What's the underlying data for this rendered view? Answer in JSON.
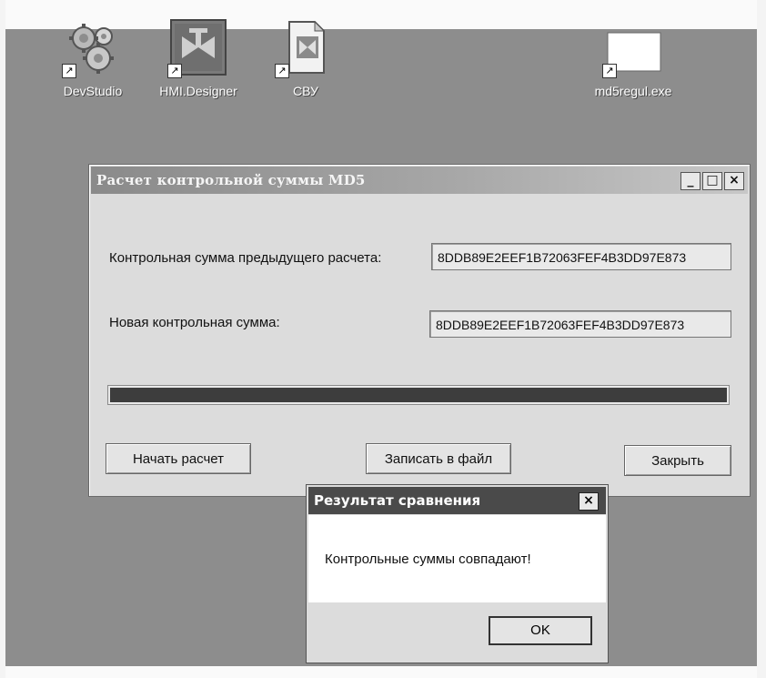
{
  "desktop": {
    "icons": [
      {
        "name": "DevStudio",
        "icon": "gears-icon"
      },
      {
        "name": "HMI.Designer",
        "icon": "valve-icon"
      },
      {
        "name": "СВУ",
        "icon": "document-icon"
      },
      {
        "name": "md5regul.exe",
        "icon": "blank-window-icon"
      }
    ],
    "shortcut_glyph": "↗"
  },
  "main_window": {
    "title": "Расчет контрольной суммы MD5",
    "controls": {
      "minimize": "_",
      "maximize": "□",
      "close": "×"
    },
    "previous_checksum_label": "Контрольная сумма предыдущего расчета:",
    "previous_checksum_value": "8DDB89E2EEF1B72063FEF4B3DD97E873",
    "new_checksum_label": "Новая контрольная сумма:",
    "new_checksum_value": "8DDB89E2EEF1B72063FEF4B3DD97E873",
    "progress": 1.0,
    "buttons": {
      "start": "Начать расчет",
      "save": "Записать в файл",
      "close": "Закрыть"
    }
  },
  "dialog": {
    "title": "Результат сравнения",
    "close_glyph": "×",
    "message": "Контрольные суммы совпадают!",
    "ok": "OK"
  },
  "colors": {
    "desktop": "#8d8d8d",
    "window": "#dcdcdc",
    "titlebar": "#8a8a8a",
    "dialog_titlebar": "#4a4a4a",
    "progress_fill": "#3d3d3d"
  }
}
